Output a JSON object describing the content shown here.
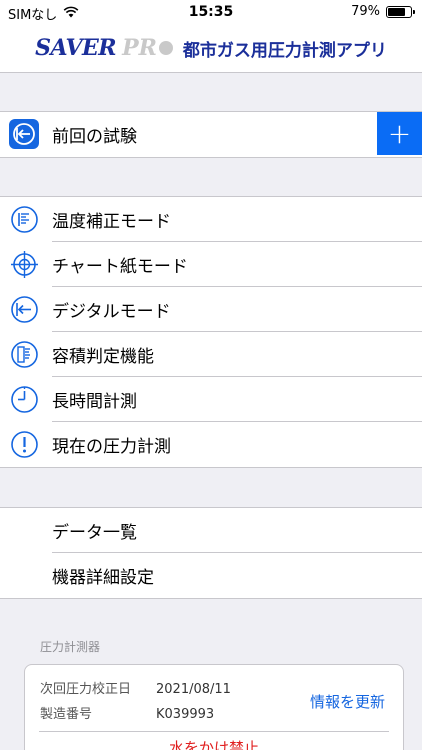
{
  "status_bar": {
    "carrier": "SIMなし",
    "time": "15:35",
    "battery_percent": "79%",
    "battery_level": 0.79,
    "wifi_icon": "wifi-icon",
    "battery_icon": "battery-icon"
  },
  "nav": {
    "brand": "SAVER",
    "brand_suffix": "PR",
    "title": "都市ガス用圧力計測アプリ"
  },
  "previous_test": {
    "label": "前回の試験",
    "icon": "arrow-left-circle-icon",
    "add_icon": "+"
  },
  "modes": [
    {
      "label": "温度補正モード",
      "icon": "thermometer-gauge-icon"
    },
    {
      "label": "チャート紙モード",
      "icon": "crosshair-icon"
    },
    {
      "label": "デジタルモード",
      "icon": "arrow-left-circle-icon"
    },
    {
      "label": "容積判定機能",
      "icon": "volume-gauge-icon"
    },
    {
      "label": "長時間計測",
      "icon": "clock-icon"
    },
    {
      "label": "現在の圧力計測",
      "icon": "exclamation-circle-icon"
    }
  ],
  "data_menu": [
    {
      "label": "データ一覧"
    },
    {
      "label": "機器詳細設定"
    }
  ],
  "instrument": {
    "section_title": "圧力計測器",
    "calibration_key": "次回圧力校正日",
    "calibration_value": "2021/08/11",
    "serial_key": "製造番号",
    "serial_value": "K039993",
    "update_link": "情報を更新",
    "warning": "水をかけ禁止"
  },
  "colors": {
    "accent": "#1566e0",
    "brand": "#1b2f9a",
    "warning": "#e02020"
  }
}
